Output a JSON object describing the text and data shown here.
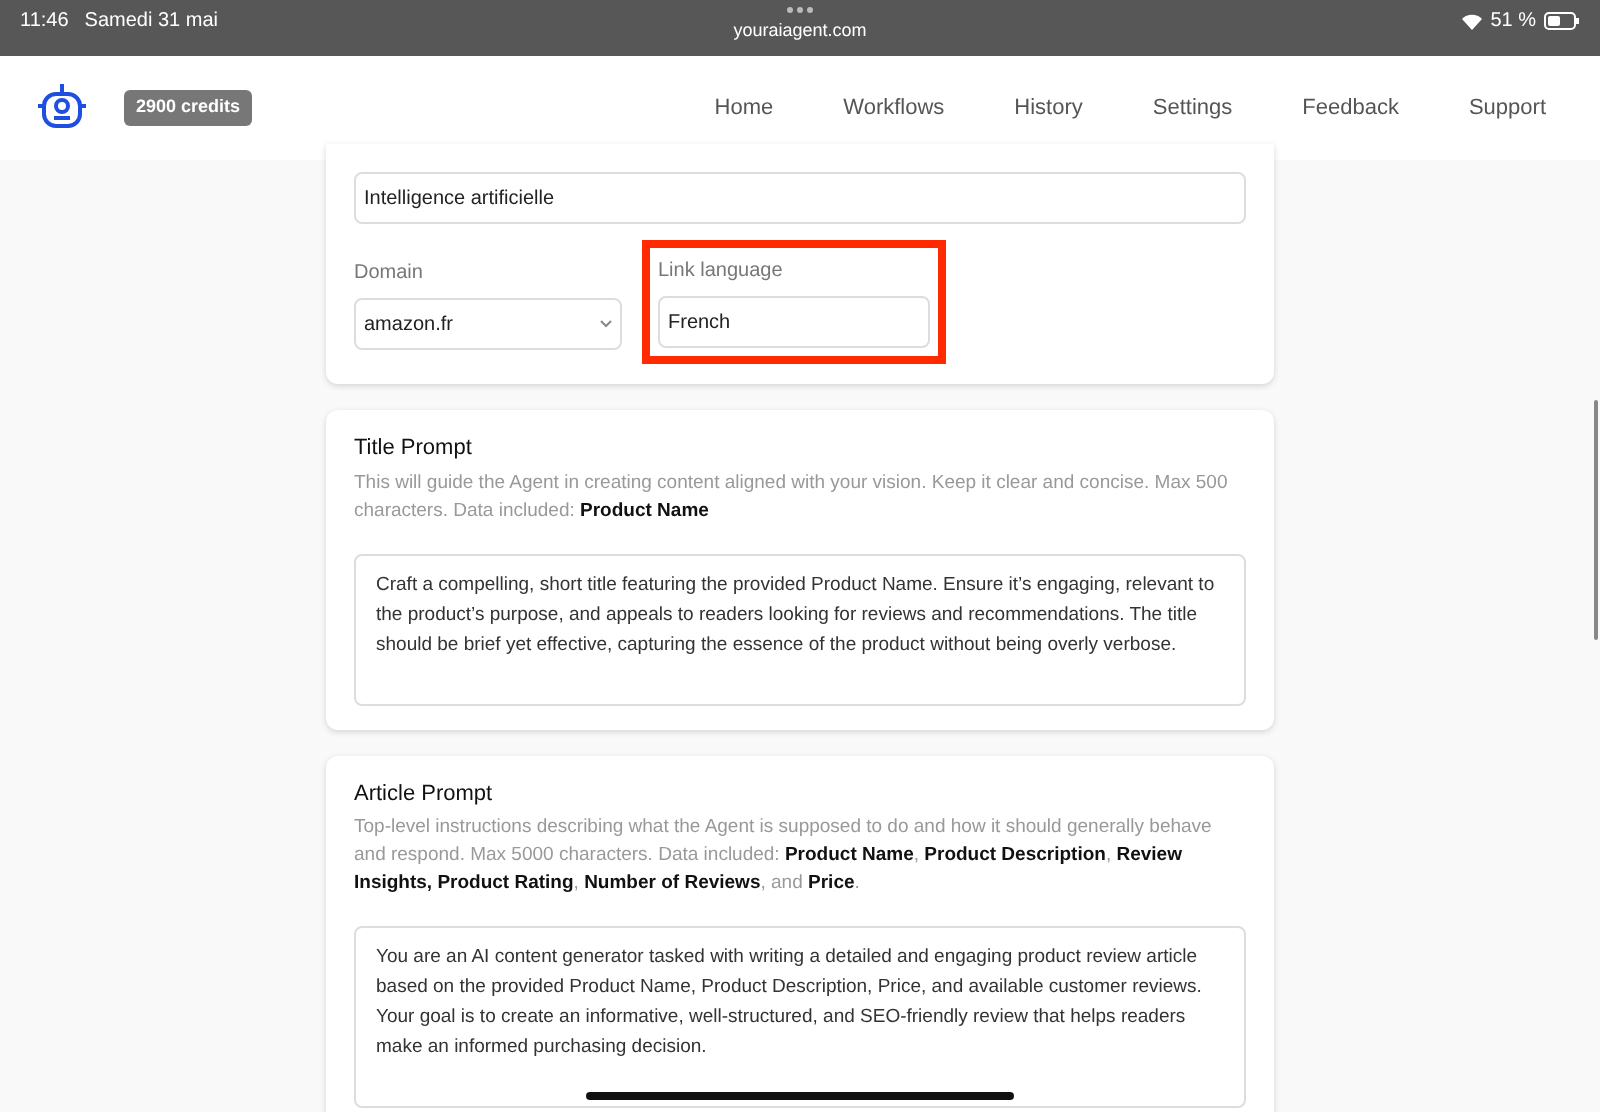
{
  "status_bar": {
    "time": "11:46",
    "date": "Samedi 31 mai",
    "url": "youraiagent.com",
    "battery": "51 %"
  },
  "header": {
    "credits": "2900 credits",
    "nav": [
      {
        "label": "Home"
      },
      {
        "label": "Workflows"
      },
      {
        "label": "History"
      },
      {
        "label": "Settings"
      },
      {
        "label": "Feedback"
      },
      {
        "label": "Support"
      }
    ]
  },
  "settings_card": {
    "keyword_value": "Intelligence artificielle",
    "domain": {
      "label": "Domain",
      "value": "amazon.fr"
    },
    "link_language": {
      "label": "Link language",
      "value": "French",
      "highlighted": true
    }
  },
  "prompts": [
    {
      "title": "Title Prompt",
      "description": "This will guide the Agent in creating content aligned with your vision. Keep it clear and concise. Max 500 characters. Data included: **Product Name**",
      "value": "Craft a compelling, short title featuring the provided Product Name. Ensure it’s engaging, relevant to the product’s purpose, and appeals to readers looking for reviews and recommendations. The title should be brief yet effective, capturing the essence of the product without being overly verbose."
    },
    {
      "title": "Article Prompt",
      "description": "Top-level instructions describing what the Agent is supposed to do and how it should generally behave and respond. Max 5000 characters. Data included: **Product Name**, **Product Description**, **Review Insights, Product Rating**, **Number of Reviews**, and **Price**.",
      "value": "You are an AI content generator tasked with writing a detailed and engaging product review article based on the provided Product Name, Product Description, Price, and available customer reviews. Your goal is to create an informative, well-structured, and SEO-friendly review that helps readers make an informed purchasing decision."
    }
  ]
}
